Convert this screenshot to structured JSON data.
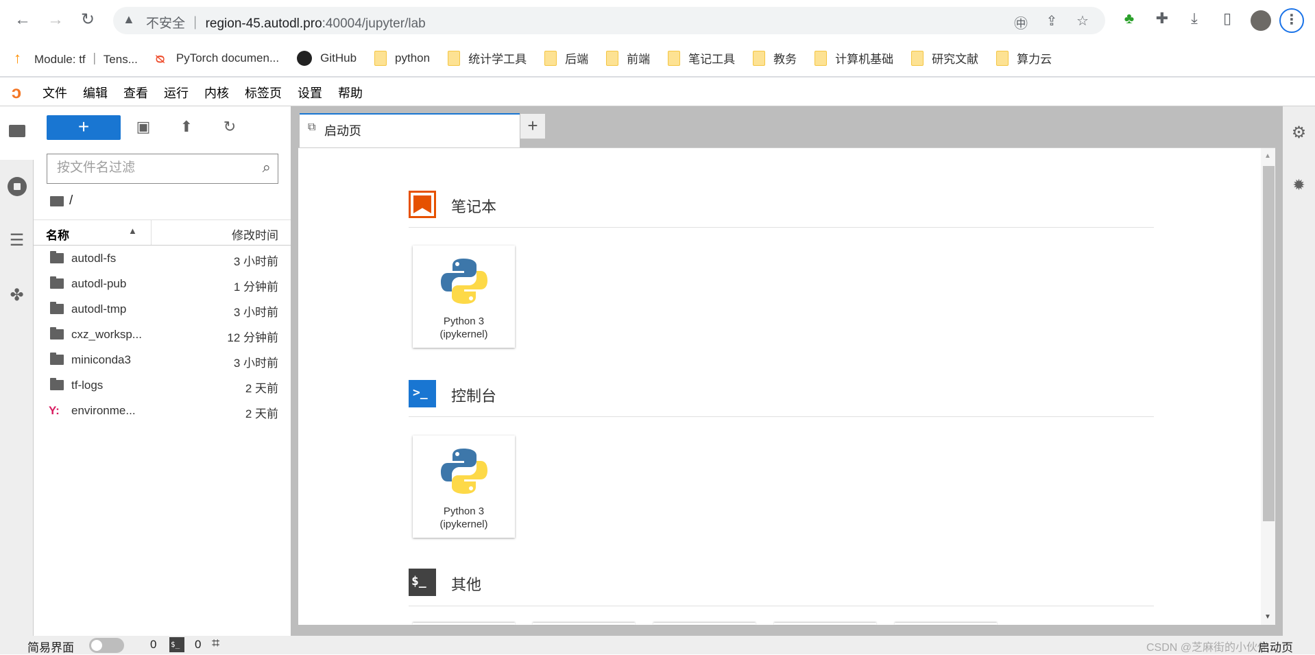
{
  "browser": {
    "security_label": "不安全",
    "url_host": "region-45.autodl.pro",
    "url_rest": ":40004/jupyter/lab",
    "bookmarks": [
      {
        "label": "Module: tf ｜ Tens...",
        "icon": "tensorflow-icon"
      },
      {
        "label": "PyTorch documen...",
        "icon": "pytorch-icon"
      },
      {
        "label": "GitHub",
        "icon": "github-icon"
      },
      {
        "label": "python",
        "icon": "folder-icon"
      },
      {
        "label": "统计学工具",
        "icon": "folder-icon"
      },
      {
        "label": "后端",
        "icon": "folder-icon"
      },
      {
        "label": "前端",
        "icon": "folder-icon"
      },
      {
        "label": "笔记工具",
        "icon": "folder-icon"
      },
      {
        "label": "教务",
        "icon": "folder-icon"
      },
      {
        "label": "计算机基础",
        "icon": "folder-icon"
      },
      {
        "label": "研究文献",
        "icon": "folder-icon"
      },
      {
        "label": "算力云",
        "icon": "folder-icon"
      }
    ]
  },
  "menu": [
    "文件",
    "编辑",
    "查看",
    "运行",
    "内核",
    "标签页",
    "设置",
    "帮助"
  ],
  "file_browser": {
    "filter_placeholder": "按文件名过滤",
    "path": "/",
    "col_name": "名称",
    "col_modified": "修改时间",
    "files": [
      {
        "name": "autodl-fs",
        "modified": "3 小时前",
        "type": "folder"
      },
      {
        "name": "autodl-pub",
        "modified": "1 分钟前",
        "type": "folder"
      },
      {
        "name": "autodl-tmp",
        "modified": "3 小时前",
        "type": "folder"
      },
      {
        "name": "cxz_worksp...",
        "modified": "12 分钟前",
        "type": "folder"
      },
      {
        "name": "miniconda3",
        "modified": "3 小时前",
        "type": "folder"
      },
      {
        "name": "tf-logs",
        "modified": "2 天前",
        "type": "folder"
      },
      {
        "name": "environme...",
        "modified": "2 天前",
        "type": "yaml"
      }
    ]
  },
  "tabs": [
    {
      "label": "启动页",
      "active": true
    }
  ],
  "launcher": {
    "sections": [
      {
        "title": "笔记本",
        "cards": [
          {
            "line1": "Python 3",
            "line2": "(ipykernel)"
          }
        ]
      },
      {
        "title": "控制台",
        "cards": [
          {
            "line1": "Python 3",
            "line2": "(ipykernel)"
          }
        ]
      },
      {
        "title": "其他"
      }
    ]
  },
  "status": {
    "simple_mode": "简易界面",
    "simple_mode_on": false,
    "kernels": "0",
    "terminals": "0",
    "current_tab": "启动页"
  },
  "watermark": "CSDN @芝麻街的小伙伴",
  "colors": {
    "accent": "#1976d2",
    "notebook": "#e65100",
    "console": "#1976d2"
  }
}
